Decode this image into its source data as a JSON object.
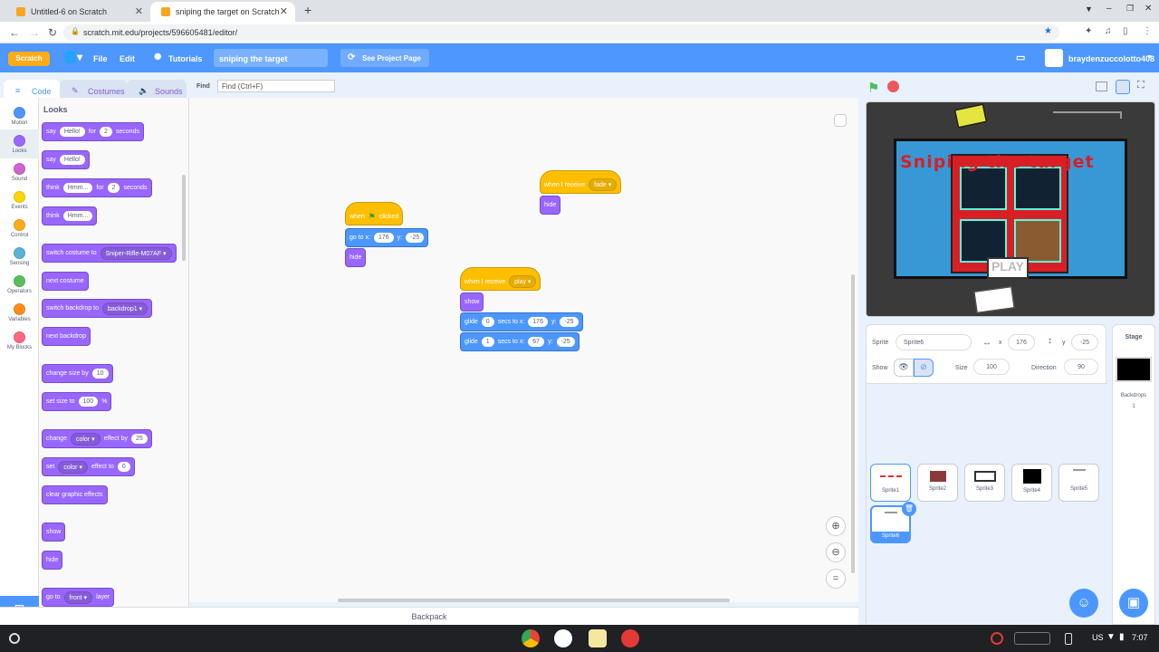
{
  "browser": {
    "tabs": [
      {
        "title": "Untitled-6 on Scratch",
        "active": false
      },
      {
        "title": "sniping the target on Scratch",
        "active": true
      }
    ],
    "new_tab": "+",
    "url": "scratch.mit.edu/projects/596605481/editor/"
  },
  "menu": {
    "logo": "Scratch",
    "file": "File",
    "edit": "Edit",
    "tutorials": "Tutorials",
    "project_title": "sniping the target",
    "see_project_page": "See Project Page",
    "username": "braydenzuccolotto408"
  },
  "editor_tabs": {
    "code": "Code",
    "costumes": "Costumes",
    "sounds": "Sounds"
  },
  "find": {
    "label": "Find",
    "placeholder": "Find (Ctrl+F)"
  },
  "categories": [
    {
      "label": "Motion",
      "color": "#4c97ff"
    },
    {
      "label": "Looks",
      "color": "#9966ff"
    },
    {
      "label": "Sound",
      "color": "#cf63cf"
    },
    {
      "label": "Events",
      "color": "#ffd500"
    },
    {
      "label": "Control",
      "color": "#ffab19"
    },
    {
      "label": "Sensing",
      "color": "#5cb1d6"
    },
    {
      "label": "Operators",
      "color": "#59c059"
    },
    {
      "label": "Variables",
      "color": "#ff8c1a"
    },
    {
      "label": "My Blocks",
      "color": "#ff6680"
    }
  ],
  "palette": {
    "heading": "Looks",
    "say_for": {
      "a": "say",
      "msg": "Hello!",
      "b": "for",
      "secs": "2",
      "c": "seconds"
    },
    "say": {
      "a": "say",
      "msg": "Hello!"
    },
    "think_for": {
      "a": "think",
      "msg": "Hmm...",
      "b": "for",
      "secs": "2",
      "c": "seconds"
    },
    "think": {
      "a": "think",
      "msg": "Hmm..."
    },
    "switch_costume": {
      "a": "switch costume to",
      "value": "Sniper-Rifle-M07AF"
    },
    "next_costume": "next costume",
    "switch_backdrop": {
      "a": "switch backdrop to",
      "value": "backdrop1"
    },
    "next_backdrop": "next backdrop",
    "change_size": {
      "a": "change size by",
      "value": "10"
    },
    "set_size": {
      "a": "set size to",
      "value": "100",
      "b": "%"
    },
    "change_effect": {
      "a": "change",
      "effect": "color",
      "b": "effect by",
      "value": "25"
    },
    "set_effect": {
      "a": "set",
      "effect": "color",
      "b": "effect to",
      "value": "0"
    },
    "clear_effects": "clear graphic effects",
    "show": "show",
    "hide": "hide",
    "go_to_layer": {
      "a": "go to",
      "value": "front",
      "b": "layer"
    }
  },
  "scripts": {
    "flag_script": {
      "hat": {
        "a": "when",
        "b": "clicked"
      },
      "goto": {
        "a": "go to x:",
        "x": "176",
        "b": "y:",
        "y": "-25"
      },
      "hide": "hide"
    },
    "fade_script": {
      "hat": {
        "a": "when I receive",
        "value": "fade"
      },
      "hide": "hide"
    },
    "play_script": {
      "hat": {
        "a": "when I receive",
        "value": "play"
      },
      "show": "show",
      "glide1": {
        "a": "glide",
        "secs": "0",
        "b": "secs to x:",
        "x": "176",
        "c": "y:",
        "y": "-25"
      },
      "glide2": {
        "a": "glide",
        "secs": "1",
        "b": "secs to x:",
        "x": "67",
        "c": "y:",
        "y": "-25"
      }
    }
  },
  "backpack": "Backpack",
  "stage": {
    "title_art": "Sniping the target",
    "play_button": "PLAY"
  },
  "sprite_info": {
    "sprite_label": "Sprite",
    "sprite_name": "Sprite6",
    "x_label": "x",
    "x": "176",
    "y_label": "y",
    "y": "-25",
    "show_label": "Show",
    "size_label": "Size",
    "size": "100",
    "direction_label": "Direction",
    "direction": "90"
  },
  "sprites": [
    {
      "name": "Sprite1"
    },
    {
      "name": "Sprite2"
    },
    {
      "name": "Sprite3"
    },
    {
      "name": "Sprite4"
    },
    {
      "name": "Sprite5"
    },
    {
      "name": "Sprite6",
      "selected": true
    }
  ],
  "stage_panel": {
    "title": "Stage",
    "backdrops_label": "Backdrops",
    "backdrops_count": "1"
  },
  "shelf": {
    "keyboard": "US",
    "time": "7:07"
  },
  "colors": {
    "scratch_blue": "#4d97ff",
    "looks": "#9966ff",
    "events": "#ffbf00",
    "motion": "#4c97ff"
  }
}
